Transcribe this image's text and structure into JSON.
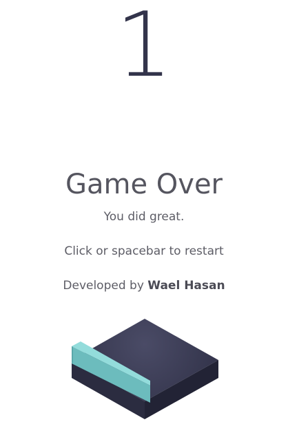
{
  "game": {
    "score": "1",
    "title": "Game Over",
    "message": "You did great.",
    "instruction": "Click or spacebar to restart",
    "credit_prefix": "Developed by",
    "credit_author": "Wael Hasan"
  },
  "colors": {
    "score": "#33344b",
    "block_top": "#3a3b55",
    "block_left": "#2b2c40",
    "block_right": "#242537",
    "slab_top": "#8fd7d6",
    "slab_front": "#6fbfc0"
  },
  "scene": {
    "objects": [
      "base-block-icon",
      "teal-slab-icon"
    ]
  }
}
